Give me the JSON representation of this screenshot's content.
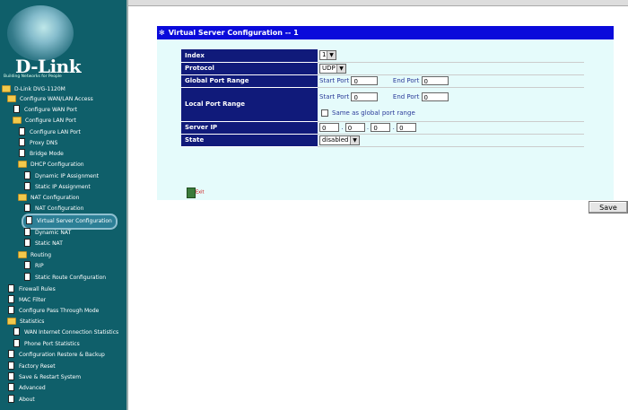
{
  "brand": {
    "name": "D-Link",
    "tagline": "Building Networks for People"
  },
  "sidebar": {
    "items": [
      {
        "label": "D-Link DVG-1120M",
        "icon": "folder-icon"
      },
      {
        "label": "Configure WAN/LAN Access",
        "icon": "folder-icon"
      },
      {
        "label": "Configure WAN Port",
        "icon": "page-icon"
      },
      {
        "label": "Configure LAN Port",
        "icon": "folder-icon"
      },
      {
        "label": "Configure LAN Port",
        "icon": "page-icon"
      },
      {
        "label": "Proxy DNS",
        "icon": "page-icon"
      },
      {
        "label": "Bridge Mode",
        "icon": "page-icon"
      },
      {
        "label": "DHCP Configuration",
        "icon": "folder-icon"
      },
      {
        "label": "Dynamic IP Assignment",
        "icon": "page-icon"
      },
      {
        "label": "Static IP Assignment",
        "icon": "page-icon"
      },
      {
        "label": "NAT Configuration",
        "icon": "folder-icon"
      },
      {
        "label": "NAT Configuration",
        "icon": "page-icon"
      },
      {
        "label": "Virtual Server Configuration",
        "icon": "page-icon"
      },
      {
        "label": "Dynamic NAT",
        "icon": "page-icon"
      },
      {
        "label": "Static NAT",
        "icon": "page-icon"
      },
      {
        "label": "Routing",
        "icon": "folder-icon"
      },
      {
        "label": "RIP",
        "icon": "page-icon"
      },
      {
        "label": "Static Route Configuration",
        "icon": "page-icon"
      },
      {
        "label": "Firewall Rules",
        "icon": "page-icon"
      },
      {
        "label": "MAC Filter",
        "icon": "page-icon"
      },
      {
        "label": "Configure Pass Through Mode",
        "icon": "page-icon"
      },
      {
        "label": "Statistics",
        "icon": "folder-icon"
      },
      {
        "label": "WAN Internet Connection Statistics",
        "icon": "page-icon"
      },
      {
        "label": "Phone Port Statistics",
        "icon": "page-icon"
      },
      {
        "label": "Configuration Restore & Backup",
        "icon": "page-icon"
      },
      {
        "label": "Factory Reset",
        "icon": "page-icon"
      },
      {
        "label": "Save & Restart System",
        "icon": "page-icon"
      },
      {
        "label": "Advanced",
        "icon": "page-icon"
      },
      {
        "label": "About",
        "icon": "page-icon"
      }
    ]
  },
  "panel": {
    "title": "Virtual Server Configuration -- 1",
    "title_icon": "star-icon",
    "rows": {
      "index_label": "Index",
      "index_value": "1",
      "protocol_label": "Protocol",
      "protocol_value": "UDP",
      "global_label": "Global Port Range",
      "start_port_label": "Start Port",
      "global_start": "0",
      "end_port_label": "End Port",
      "global_end": "0",
      "local_label": "Local Port Range",
      "local_start": "0",
      "local_end": "0",
      "same_as_global_label": "Same as global port range",
      "server_ip_label": "Server IP",
      "ip1": "0",
      "ip2": "0",
      "ip3": "0",
      "ip4": "0",
      "state_label": "State",
      "state_value": "disabled"
    },
    "save_label": "Save",
    "exit_label": "Exit"
  },
  "colors": {
    "sidebar_bg": "#0f5f6a",
    "title_bar": "#0a0adb",
    "label_bg": "#101a7a",
    "panel_bg": "#e5fbfb"
  }
}
